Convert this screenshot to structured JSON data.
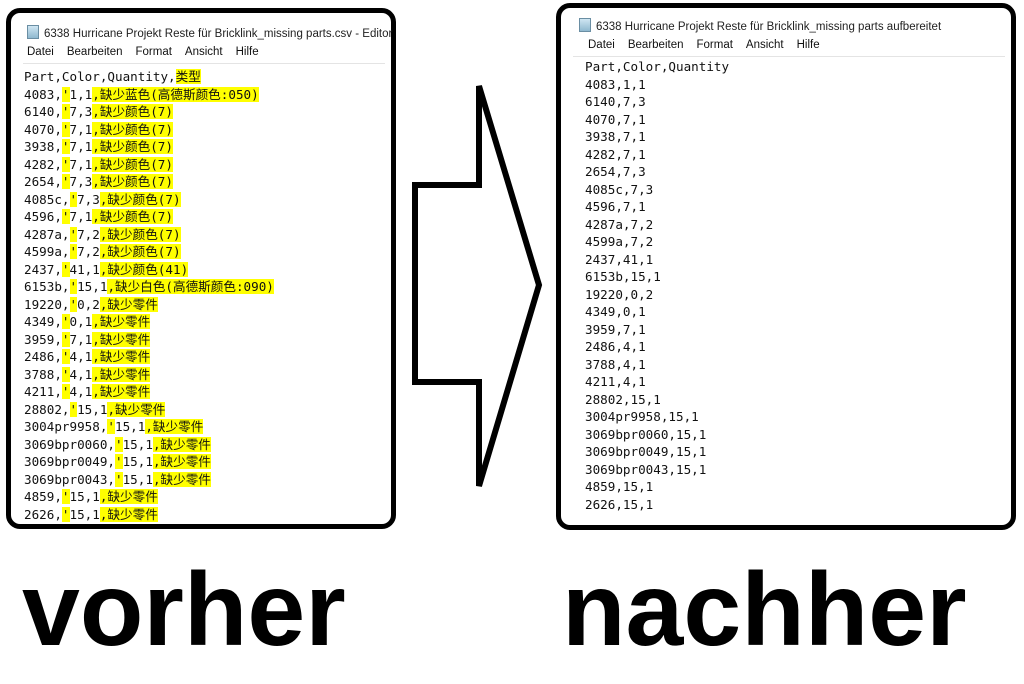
{
  "before": {
    "title": "6338 Hurricane Projekt Reste für Bricklink_missing parts.csv - Editor",
    "menu": [
      "Datei",
      "Bearbeiten",
      "Format",
      "Ansicht",
      "Hilfe"
    ],
    "header": {
      "a": "Part,Color,Quantity,",
      "c": "类型"
    },
    "rows": [
      {
        "a": "4083,",
        "q": "'",
        "b": "1,1",
        "c": ",缺少蓝色(高德斯颜色:050)"
      },
      {
        "a": "6140,",
        "q": "'",
        "b": "7,3",
        "c": ",缺少颜色(7)"
      },
      {
        "a": "4070,",
        "q": "'",
        "b": "7,1",
        "c": ",缺少颜色(7)"
      },
      {
        "a": "3938,",
        "q": "'",
        "b": "7,1",
        "c": ",缺少颜色(7)"
      },
      {
        "a": "4282,",
        "q": "'",
        "b": "7,1",
        "c": ",缺少颜色(7)"
      },
      {
        "a": "2654,",
        "q": "'",
        "b": "7,3",
        "c": ",缺少颜色(7)"
      },
      {
        "a": "4085c,",
        "q": "'",
        "b": "7,3",
        "c": ",缺少颜色(7)"
      },
      {
        "a": "4596,",
        "q": "'",
        "b": "7,1",
        "c": ",缺少颜色(7)"
      },
      {
        "a": "4287a,",
        "q": "'",
        "b": "7,2",
        "c": ",缺少颜色(7)"
      },
      {
        "a": "4599a,",
        "q": "'",
        "b": "7,2",
        "c": ",缺少颜色(7)"
      },
      {
        "a": "2437,",
        "q": "'",
        "b": "41,1",
        "c": ",缺少颜色(41)"
      },
      {
        "a": "6153b,",
        "q": "'",
        "b": "15,1",
        "c": ",缺少白色(高德斯颜色:090)"
      },
      {
        "a": "19220,",
        "q": "'",
        "b": "0,2",
        "c": ",缺少零件"
      },
      {
        "a": "4349,",
        "q": "'",
        "b": "0,1",
        "c": ",缺少零件"
      },
      {
        "a": "3959,",
        "q": "'",
        "b": "7,1",
        "c": ",缺少零件"
      },
      {
        "a": "2486,",
        "q": "'",
        "b": "4,1",
        "c": ",缺少零件"
      },
      {
        "a": "3788,",
        "q": "'",
        "b": "4,1",
        "c": ",缺少零件"
      },
      {
        "a": "4211,",
        "q": "'",
        "b": "4,1",
        "c": ",缺少零件"
      },
      {
        "a": "28802,",
        "q": "'",
        "b": "15,1",
        "c": ",缺少零件"
      },
      {
        "a": "3004pr9958,",
        "q": "'",
        "b": "15,1",
        "c": ",缺少零件"
      },
      {
        "a": "3069bpr0060,",
        "q": "'",
        "b": "15,1",
        "c": ",缺少零件"
      },
      {
        "a": "3069bpr0049,",
        "q": "'",
        "b": "15,1",
        "c": ",缺少零件"
      },
      {
        "a": "3069bpr0043,",
        "q": "'",
        "b": "15,1",
        "c": ",缺少零件"
      },
      {
        "a": "4859,",
        "q": "'",
        "b": "15,1",
        "c": ",缺少零件"
      },
      {
        "a": "2626,",
        "q": "'",
        "b": "15,1",
        "c": ",缺少零件"
      }
    ]
  },
  "after": {
    "title": "6338 Hurricane Projekt Reste für Bricklink_missing parts aufbereitet",
    "menu": [
      "Datei",
      "Bearbeiten",
      "Format",
      "Ansicht",
      "Hilfe"
    ],
    "lines": [
      "Part,Color,Quantity",
      "4083,1,1",
      "6140,7,3",
      "4070,7,1",
      "3938,7,1",
      "4282,7,1",
      "2654,7,3",
      "4085c,7,3",
      "4596,7,1",
      "4287a,7,2",
      "4599a,7,2",
      "2437,41,1",
      "6153b,15,1",
      "19220,0,2",
      "4349,0,1",
      "3959,7,1",
      "2486,4,1",
      "3788,4,1",
      "4211,4,1",
      "28802,15,1",
      "3004pr9958,15,1",
      "3069bpr0060,15,1",
      "3069bpr0049,15,1",
      "3069bpr0043,15,1",
      "4859,15,1",
      "2626,15,1"
    ]
  },
  "labels": {
    "before": "vorher",
    "after": "nachher"
  },
  "colors": {
    "highlight": "#ffff00"
  }
}
